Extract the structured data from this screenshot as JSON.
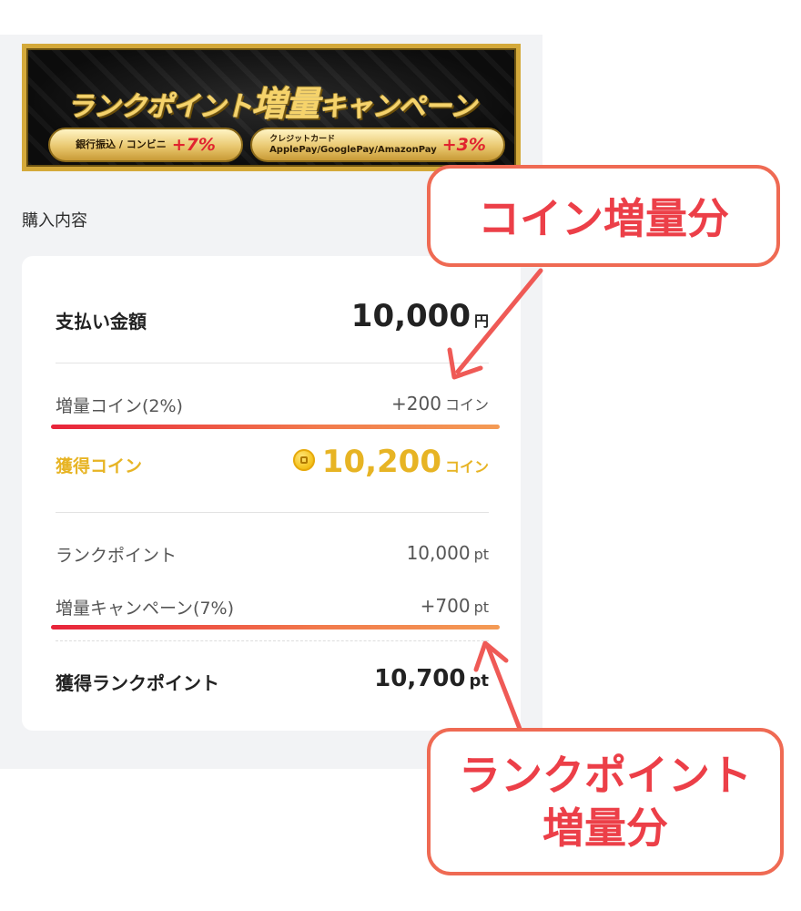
{
  "banner": {
    "title_part1": "ランクポイント",
    "title_part2": "増量",
    "title_part3": "キャンペーン",
    "pill1_text": "銀行振込 / コンビニ",
    "pill1_percent": "+7%",
    "pill2_line1": "クレジットカード",
    "pill2_line2": "ApplePay/GooglePay/AmazonPay",
    "pill2_percent": "+3%"
  },
  "section": {
    "title": "購入内容"
  },
  "payment": {
    "label": "支払い金額",
    "value": "10,000",
    "unit": "円"
  },
  "bonus_coin": {
    "label": "増量コイン(2%)",
    "value": "+200",
    "unit": "コイン"
  },
  "earned_coin": {
    "label": "獲得コイン",
    "value": "10,200",
    "unit": "コイン"
  },
  "rank_point": {
    "label": "ランクポイント",
    "value": "10,000",
    "unit": "pt"
  },
  "campaign": {
    "label": "増量キャンペーン(7%)",
    "value": "+700",
    "unit": "pt"
  },
  "earned_rank": {
    "label": "獲得ランクポイント",
    "value": "10,700",
    "unit": "pt"
  },
  "annotations": {
    "coin_callout": "コイン増量分",
    "rank_callout_line1": "ランクポイント",
    "rank_callout_line2": "増量分"
  },
  "colors": {
    "accent_gold": "#e7b424",
    "annotation_red": "#ec3f48",
    "highlight_start": "#e8233a",
    "highlight_end": "#f49b55"
  },
  "icons": {
    "coin": "coin-icon"
  }
}
